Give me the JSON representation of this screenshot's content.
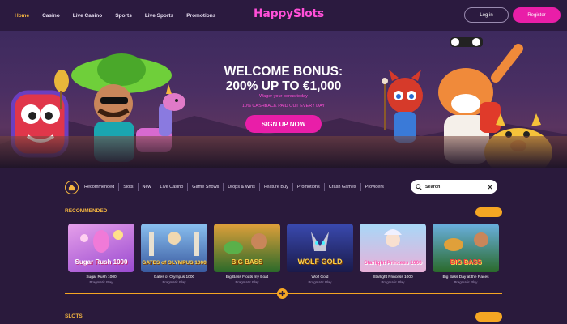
{
  "nav": {
    "links": [
      "Home",
      "Casino",
      "Live Casino",
      "Sports",
      "Live Sports",
      "Promotions"
    ],
    "active_index": 0,
    "logo": "HappySlots",
    "login_label": "Log in",
    "register_label": "Register"
  },
  "hero": {
    "title_line1": "WELCOME BONUS:",
    "title_line2": "200% UP TO €1,000",
    "subtitle1": "Wager your bonus today",
    "subtitle2": "10% CASHBACK PAID OUT EVERY DAY",
    "signup_label": "SIGN UP NOW"
  },
  "categories": [
    "Recommended",
    "Slots",
    "New",
    "Live Casino",
    "Game Shows",
    "Drops & Wins",
    "Feature Buy",
    "Promotions",
    "Crash Games",
    "Providers"
  ],
  "search": {
    "placeholder": "Search"
  },
  "sections": {
    "recommended": "RECOMMENDED",
    "slots": "SLOTS"
  },
  "games": [
    {
      "name": "Sugar Rush 1000",
      "provider": "Pragmatic Play",
      "logo": "Sugar Rush 1000",
      "bg": "#c07adf"
    },
    {
      "name": "Gates of Olympus 1000",
      "provider": "Pragmatic Play",
      "logo": "GATES of OLYMPUS 1000",
      "bg": "#6a9ad0"
    },
    {
      "name": "Big Bass Floats my Boat",
      "provider": "Pragmatic Play",
      "logo": "BIG BASS",
      "bg": "#3a7a3a"
    },
    {
      "name": "Wolf Gold",
      "provider": "Pragmatic Play",
      "logo": "WOLF GOLD",
      "bg": "#2a3a7a"
    },
    {
      "name": "Starlight Princess 1000",
      "provider": "Pragmatic Play",
      "logo": "Starlight Princess 1000",
      "bg": "#8ab8e8"
    },
    {
      "name": "Big Bass Day at the Races",
      "provider": "Pragmatic Play",
      "logo": "BIG BASS",
      "bg": "#2f7a3a"
    }
  ],
  "colors": {
    "accent": "#f5a623",
    "brand_pink": "#e91ea8",
    "background": "#2a1a3c"
  }
}
